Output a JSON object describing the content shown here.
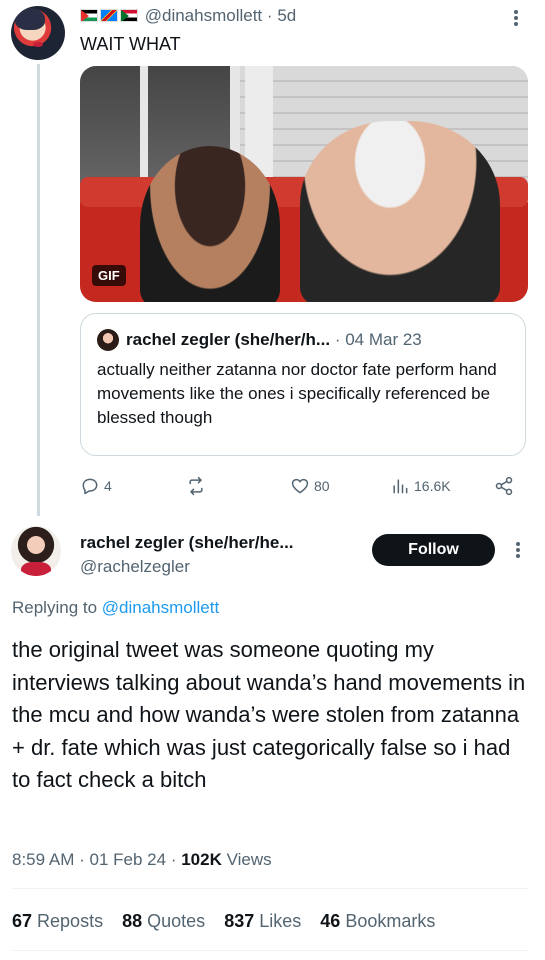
{
  "parent_tweet": {
    "author_handle": "@dinahsmollett",
    "separator": "·",
    "age": "5d",
    "text": "WAIT WHAT",
    "gif_badge": "GIF",
    "name_flags": [
      "palestine-flag",
      "congo-flag",
      "sudan-flag"
    ],
    "quoted": {
      "author": "rachel zegler (she/her/h...",
      "separator": "·",
      "date": "04 Mar 23",
      "text": "actually neither zatanna nor doctor fate perform hand movements like the ones i specifically referenced be blessed though"
    },
    "actions": {
      "replies": "4",
      "likes": "80",
      "views": "16.6K"
    }
  },
  "main_tweet": {
    "author_name": "rachel zegler (she/her/he...",
    "author_handle": "@rachelzegler",
    "follow_label": "Follow",
    "replying_prefix": "Replying to ",
    "replying_to": "@dinahsmollett",
    "text": "the original tweet was someone quoting my interviews talking about wanda’s hand movements in the mcu and how wanda’s were stolen from zatanna + dr. fate which was just categorically false so i had to fact check a bitch",
    "time": "8:59 AM",
    "sep1": "·",
    "date": "01 Feb 24",
    "sep2": "·",
    "views_count": "102K",
    "views_label": " Views",
    "stats": {
      "reposts_count": "67",
      "reposts_label": " Reposts",
      "quotes_count": "88",
      "quotes_label": " Quotes",
      "likes_count": "837",
      "likes_label": " Likes",
      "bookmarks_count": "46",
      "bookmarks_label": " Bookmarks"
    }
  },
  "colors": {
    "text": "#0f1419",
    "muted": "#536471",
    "link": "#1d9bf0",
    "border": "#cfd9de"
  }
}
